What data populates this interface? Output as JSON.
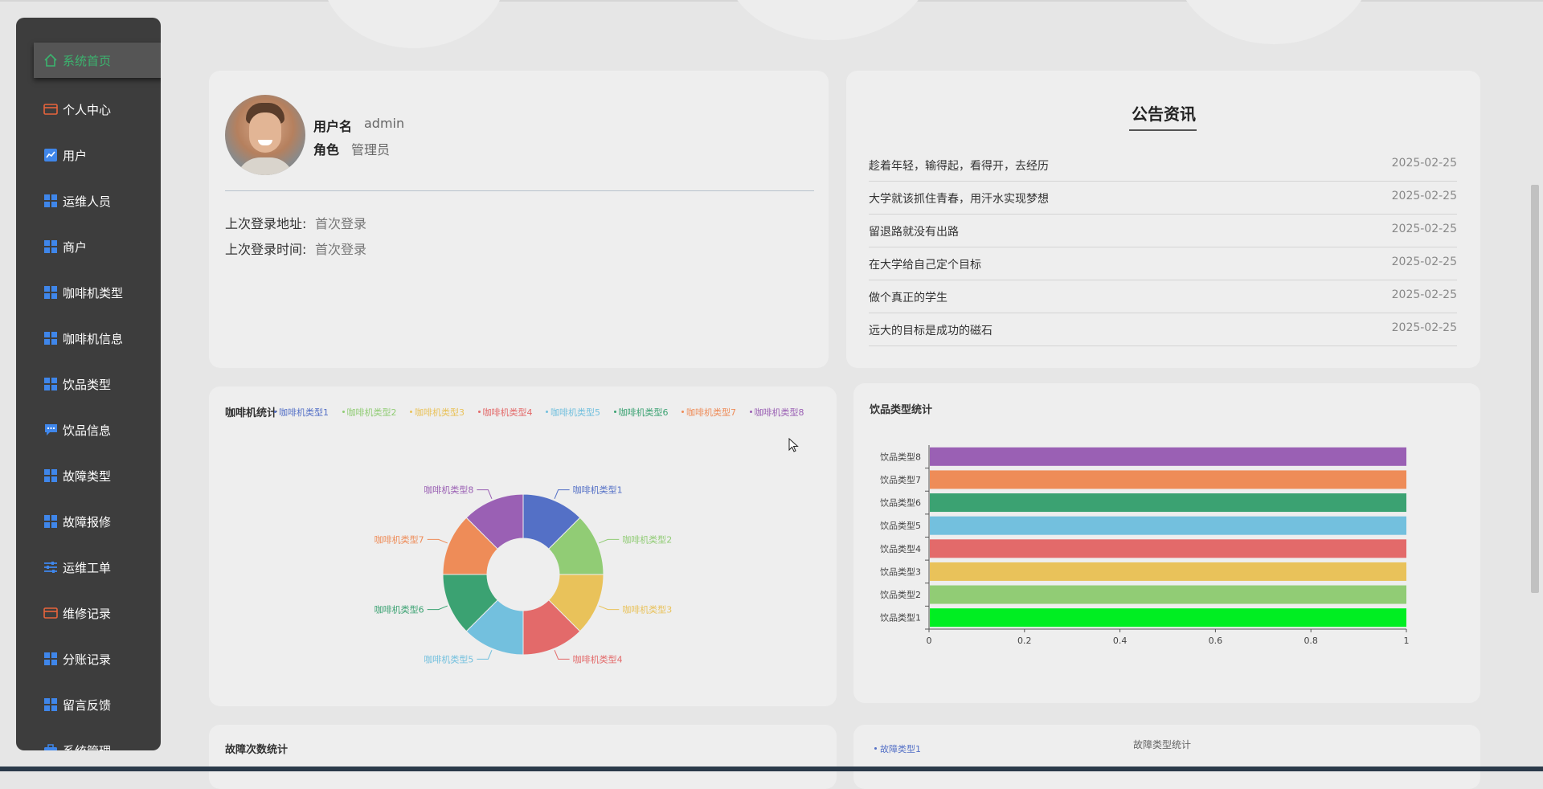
{
  "sidebar": {
    "items": [
      {
        "label": "系统首页",
        "icon": "home-icon",
        "active": true
      },
      {
        "label": "个人中心",
        "icon": "wallet-icon"
      },
      {
        "label": "用户",
        "icon": "chart-icon"
      },
      {
        "label": "运维人员",
        "icon": "grid-icon"
      },
      {
        "label": "商户",
        "icon": "grid-icon"
      },
      {
        "label": "咖啡机类型",
        "icon": "grid-icon"
      },
      {
        "label": "咖啡机信息",
        "icon": "grid-icon"
      },
      {
        "label": "饮品类型",
        "icon": "grid-icon"
      },
      {
        "label": "饮品信息",
        "icon": "chat-icon"
      },
      {
        "label": "故障类型",
        "icon": "grid-icon"
      },
      {
        "label": "故障报修",
        "icon": "grid-icon"
      },
      {
        "label": "运维工单",
        "icon": "sliders-icon"
      },
      {
        "label": "维修记录",
        "icon": "wallet-icon"
      },
      {
        "label": "分账记录",
        "icon": "grid-icon"
      },
      {
        "label": "留言反馈",
        "icon": "grid-icon"
      },
      {
        "label": "系统管理",
        "icon": "briefcase-icon"
      }
    ]
  },
  "profile": {
    "username_label": "用户名",
    "username": "admin",
    "role_label": "角色",
    "role": "管理员",
    "last_login_addr_label": "上次登录地址:",
    "last_login_addr": "首次登录",
    "last_login_time_label": "上次登录时间:",
    "last_login_time": "首次登录"
  },
  "news": {
    "title": "公告资讯",
    "items": [
      {
        "text": "趁着年轻，输得起，看得开，去经历",
        "date": "2025-02-25"
      },
      {
        "text": "大学就该抓住青春，用汗水实现梦想",
        "date": "2025-02-25"
      },
      {
        "text": "留退路就没有出路",
        "date": "2025-02-25"
      },
      {
        "text": "在大学给自己定个目标",
        "date": "2025-02-25"
      },
      {
        "text": "做个真正的学生",
        "date": "2025-02-25"
      },
      {
        "text": "远大的目标是成功的磁石",
        "date": "2025-02-25"
      }
    ]
  },
  "colors": {
    "c1": "#5470c6",
    "c2": "#91cc75",
    "c3": "#e9c25a",
    "c4": "#e36a6a",
    "c5": "#73c0de",
    "c6": "#3ba272",
    "c7": "#ee8c58",
    "c8": "#9a60b4",
    "bar1": "#00ee22"
  },
  "chart_data": [
    {
      "type": "pie",
      "title": "咖啡机统计",
      "legend_position": "top",
      "categories": [
        "咖啡机类型1",
        "咖啡机类型2",
        "咖啡机类型3",
        "咖啡机类型4",
        "咖啡机类型5",
        "咖啡机类型6",
        "咖啡机类型7",
        "咖啡机类型8"
      ],
      "values": [
        1,
        1,
        1,
        1,
        1,
        1,
        1,
        1
      ]
    },
    {
      "type": "bar",
      "orientation": "horizontal",
      "title": "饮品类型统计",
      "categories": [
        "饮品类型1",
        "饮品类型2",
        "饮品类型3",
        "饮品类型4",
        "饮品类型5",
        "饮品类型6",
        "饮品类型7",
        "饮品类型8"
      ],
      "values": [
        1,
        1,
        1,
        1,
        1,
        1,
        1,
        1
      ],
      "xlim": [
        0,
        1
      ],
      "xticks": [
        "0",
        "0.2",
        "0.4",
        "0.6",
        "0.8",
        "1"
      ]
    },
    {
      "type": "bar",
      "title": "故障次数统计"
    },
    {
      "type": "pie",
      "title": "故障类型统计",
      "categories": [
        "故障类型1"
      ]
    }
  ]
}
